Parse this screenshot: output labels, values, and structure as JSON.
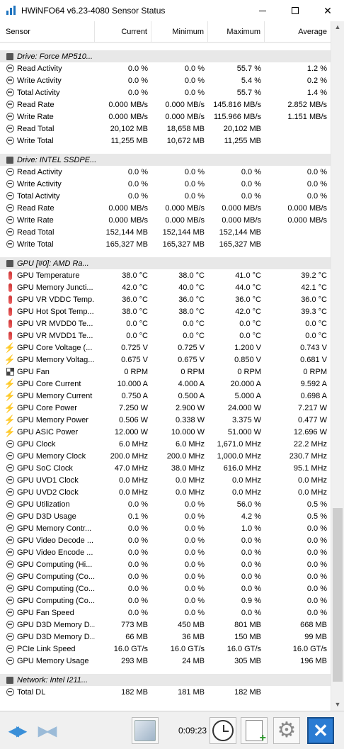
{
  "window": {
    "title": "HWiNFO64 v6.23-4080 Sensor Status"
  },
  "columns": [
    "Sensor",
    "Current",
    "Minimum",
    "Maximum",
    "Average"
  ],
  "groups": [
    {
      "name": "Drive: Force MP510...",
      "rows": [
        {
          "icon": "circle",
          "name": "Read Activity",
          "cur": "0.0 %",
          "min": "0.0 %",
          "max": "55.7 %",
          "avg": "1.2 %"
        },
        {
          "icon": "circle",
          "name": "Write Activity",
          "cur": "0.0 %",
          "min": "0.0 %",
          "max": "5.4 %",
          "avg": "0.2 %"
        },
        {
          "icon": "circle",
          "name": "Total Activity",
          "cur": "0.0 %",
          "min": "0.0 %",
          "max": "55.7 %",
          "avg": "1.4 %"
        },
        {
          "icon": "circle",
          "name": "Read Rate",
          "cur": "0.000 MB/s",
          "min": "0.000 MB/s",
          "max": "145.816 MB/s",
          "avg": "2.852 MB/s"
        },
        {
          "icon": "circle",
          "name": "Write Rate",
          "cur": "0.000 MB/s",
          "min": "0.000 MB/s",
          "max": "115.966 MB/s",
          "avg": "1.151 MB/s"
        },
        {
          "icon": "circle",
          "name": "Read Total",
          "cur": "20,102 MB",
          "min": "18,658 MB",
          "max": "20,102 MB",
          "avg": ""
        },
        {
          "icon": "circle",
          "name": "Write Total",
          "cur": "11,255 MB",
          "min": "10,672 MB",
          "max": "11,255 MB",
          "avg": ""
        }
      ]
    },
    {
      "name": "Drive: INTEL SSDPE...",
      "rows": [
        {
          "icon": "circle",
          "name": "Read Activity",
          "cur": "0.0 %",
          "min": "0.0 %",
          "max": "0.0 %",
          "avg": "0.0 %"
        },
        {
          "icon": "circle",
          "name": "Write Activity",
          "cur": "0.0 %",
          "min": "0.0 %",
          "max": "0.0 %",
          "avg": "0.0 %"
        },
        {
          "icon": "circle",
          "name": "Total Activity",
          "cur": "0.0 %",
          "min": "0.0 %",
          "max": "0.0 %",
          "avg": "0.0 %"
        },
        {
          "icon": "circle",
          "name": "Read Rate",
          "cur": "0.000 MB/s",
          "min": "0.000 MB/s",
          "max": "0.000 MB/s",
          "avg": "0.000 MB/s"
        },
        {
          "icon": "circle",
          "name": "Write Rate",
          "cur": "0.000 MB/s",
          "min": "0.000 MB/s",
          "max": "0.000 MB/s",
          "avg": "0.000 MB/s"
        },
        {
          "icon": "circle",
          "name": "Read Total",
          "cur": "152,144 MB",
          "min": "152,144 MB",
          "max": "152,144 MB",
          "avg": ""
        },
        {
          "icon": "circle",
          "name": "Write Total",
          "cur": "165,327 MB",
          "min": "165,327 MB",
          "max": "165,327 MB",
          "avg": ""
        }
      ]
    },
    {
      "name": "GPU [#0]: AMD Ra...",
      "rows": [
        {
          "icon": "therm",
          "name": "GPU Temperature",
          "cur": "38.0 °C",
          "min": "38.0 °C",
          "max": "41.0 °C",
          "avg": "39.2 °C"
        },
        {
          "icon": "therm",
          "name": "GPU Memory Juncti...",
          "cur": "42.0 °C",
          "min": "40.0 °C",
          "max": "44.0 °C",
          "avg": "42.1 °C"
        },
        {
          "icon": "therm",
          "name": "GPU VR VDDC Temp...",
          "cur": "36.0 °C",
          "min": "36.0 °C",
          "max": "36.0 °C",
          "avg": "36.0 °C"
        },
        {
          "icon": "therm",
          "name": "GPU Hot Spot Temp...",
          "cur": "38.0 °C",
          "min": "38.0 °C",
          "max": "42.0 °C",
          "avg": "39.3 °C"
        },
        {
          "icon": "therm",
          "name": "GPU VR MVDD0 Te...",
          "cur": "0.0 °C",
          "min": "0.0 °C",
          "max": "0.0 °C",
          "avg": "0.0 °C"
        },
        {
          "icon": "therm",
          "name": "GPU VR MVDD1 Te...",
          "cur": "0.0 °C",
          "min": "0.0 °C",
          "max": "0.0 °C",
          "avg": "0.0 °C"
        },
        {
          "icon": "bolt",
          "name": "GPU Core Voltage (...",
          "cur": "0.725 V",
          "min": "0.725 V",
          "max": "1.200 V",
          "avg": "0.743 V"
        },
        {
          "icon": "bolt",
          "name": "GPU Memory Voltag...",
          "cur": "0.675 V",
          "min": "0.675 V",
          "max": "0.850 V",
          "avg": "0.681 V"
        },
        {
          "icon": "fan",
          "name": "GPU Fan",
          "cur": "0 RPM",
          "min": "0 RPM",
          "max": "0 RPM",
          "avg": "0 RPM"
        },
        {
          "icon": "bolt",
          "name": "GPU Core Current",
          "cur": "10.000 A",
          "min": "4.000 A",
          "max": "20.000 A",
          "avg": "9.592 A"
        },
        {
          "icon": "bolt",
          "name": "GPU Memory Current",
          "cur": "0.750 A",
          "min": "0.500 A",
          "max": "5.000 A",
          "avg": "0.698 A"
        },
        {
          "icon": "bolt",
          "name": "GPU Core Power",
          "cur": "7.250 W",
          "min": "2.900 W",
          "max": "24.000 W",
          "avg": "7.217 W"
        },
        {
          "icon": "bolt",
          "name": "GPU Memory Power",
          "cur": "0.506 W",
          "min": "0.338 W",
          "max": "3.375 W",
          "avg": "0.477 W"
        },
        {
          "icon": "bolt",
          "name": "GPU ASIC Power",
          "cur": "12.000 W",
          "min": "10.000 W",
          "max": "51.000 W",
          "avg": "12.696 W"
        },
        {
          "icon": "circle",
          "name": "GPU Clock",
          "cur": "6.0 MHz",
          "min": "6.0 MHz",
          "max": "1,671.0 MHz",
          "avg": "22.2 MHz"
        },
        {
          "icon": "circle",
          "name": "GPU Memory Clock",
          "cur": "200.0 MHz",
          "min": "200.0 MHz",
          "max": "1,000.0 MHz",
          "avg": "230.7 MHz"
        },
        {
          "icon": "circle",
          "name": "GPU SoC Clock",
          "cur": "47.0 MHz",
          "min": "38.0 MHz",
          "max": "616.0 MHz",
          "avg": "95.1 MHz"
        },
        {
          "icon": "circle",
          "name": "GPU UVD1 Clock",
          "cur": "0.0 MHz",
          "min": "0.0 MHz",
          "max": "0.0 MHz",
          "avg": "0.0 MHz"
        },
        {
          "icon": "circle",
          "name": "GPU UVD2 Clock",
          "cur": "0.0 MHz",
          "min": "0.0 MHz",
          "max": "0.0 MHz",
          "avg": "0.0 MHz"
        },
        {
          "icon": "circle",
          "name": "GPU Utilization",
          "cur": "0.0 %",
          "min": "0.0 %",
          "max": "56.0 %",
          "avg": "0.5 %"
        },
        {
          "icon": "circle",
          "name": "GPU D3D Usage",
          "cur": "0.1 %",
          "min": "0.0 %",
          "max": "4.2 %",
          "avg": "0.5 %"
        },
        {
          "icon": "circle",
          "name": "GPU Memory Contr...",
          "cur": "0.0 %",
          "min": "0.0 %",
          "max": "1.0 %",
          "avg": "0.0 %"
        },
        {
          "icon": "circle",
          "name": "GPU Video Decode ...",
          "cur": "0.0 %",
          "min": "0.0 %",
          "max": "0.0 %",
          "avg": "0.0 %"
        },
        {
          "icon": "circle",
          "name": "GPU Video Encode ...",
          "cur": "0.0 %",
          "min": "0.0 %",
          "max": "0.0 %",
          "avg": "0.0 %"
        },
        {
          "icon": "circle",
          "name": "GPU Computing (Hi...",
          "cur": "0.0 %",
          "min": "0.0 %",
          "max": "0.0 %",
          "avg": "0.0 %"
        },
        {
          "icon": "circle",
          "name": "GPU Computing (Co...",
          "cur": "0.0 %",
          "min": "0.0 %",
          "max": "0.0 %",
          "avg": "0.0 %"
        },
        {
          "icon": "circle",
          "name": "GPU Computing (Co...",
          "cur": "0.0 %",
          "min": "0.0 %",
          "max": "0.0 %",
          "avg": "0.0 %"
        },
        {
          "icon": "circle",
          "name": "GPU Computing (Co...",
          "cur": "0.0 %",
          "min": "0.0 %",
          "max": "0.9 %",
          "avg": "0.0 %"
        },
        {
          "icon": "circle",
          "name": "GPU Fan Speed",
          "cur": "0.0 %",
          "min": "0.0 %",
          "max": "0.0 %",
          "avg": "0.0 %"
        },
        {
          "icon": "circle",
          "name": "GPU D3D Memory D...",
          "cur": "773 MB",
          "min": "450 MB",
          "max": "801 MB",
          "avg": "668 MB"
        },
        {
          "icon": "circle",
          "name": "GPU D3D Memory D...",
          "cur": "66 MB",
          "min": "36 MB",
          "max": "150 MB",
          "avg": "99 MB"
        },
        {
          "icon": "circle",
          "name": "PCIe Link Speed",
          "cur": "16.0 GT/s",
          "min": "16.0 GT/s",
          "max": "16.0 GT/s",
          "avg": "16.0 GT/s"
        },
        {
          "icon": "circle",
          "name": "GPU Memory Usage",
          "cur": "293 MB",
          "min": "24 MB",
          "max": "305 MB",
          "avg": "196 MB"
        }
      ]
    },
    {
      "name": "Network: Intel I211...",
      "rows": [
        {
          "icon": "circle",
          "name": "Total DL",
          "cur": "182 MB",
          "min": "181 MB",
          "max": "182 MB",
          "avg": ""
        }
      ]
    }
  ],
  "toolbar": {
    "timer": "0:09:23"
  },
  "colors": {
    "accent": "#2b7cd3",
    "group_bg": "#e8e8e8"
  }
}
